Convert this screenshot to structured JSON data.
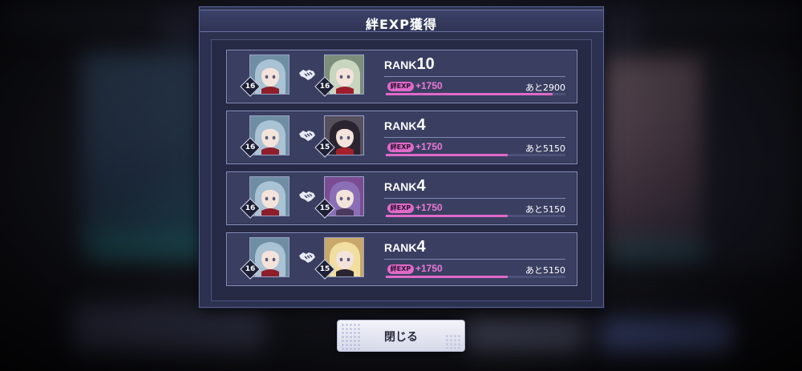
{
  "dialog": {
    "title": "絆EXP獲得"
  },
  "exp_pill_label": "絆EXP",
  "rows": [
    {
      "char_a_level": "16",
      "char_b_level": "16",
      "rank_label": "RANK",
      "rank_value": "10",
      "exp_gain": "+1750",
      "remaining": "あと2900",
      "progress": 0.93,
      "char_b_palette": {
        "hair": "#c9d6bf",
        "accent": "#9c1e2c",
        "bg": "#7d8f7a"
      }
    },
    {
      "char_a_level": "16",
      "char_b_level": "15",
      "rank_label": "RANK",
      "rank_value": "4",
      "exp_gain": "+1750",
      "remaining": "あと5150",
      "progress": 0.68,
      "char_b_palette": {
        "hair": "#2a2430",
        "accent": "#a3202c",
        "bg": "#55505c"
      }
    },
    {
      "char_a_level": "16",
      "char_b_level": "15",
      "rank_label": "RANK",
      "rank_value": "4",
      "exp_gain": "+1750",
      "remaining": "あと5150",
      "progress": 0.68,
      "char_b_palette": {
        "hair": "#8a6fb6",
        "accent": "#4b3a5c",
        "bg": "#7a4d92"
      }
    },
    {
      "char_a_level": "16",
      "char_b_level": "15",
      "rank_label": "RANK",
      "rank_value": "4",
      "exp_gain": "+1750",
      "remaining": "あと5150",
      "progress": 0.68,
      "char_b_palette": {
        "hair": "#f0dfa0",
        "accent": "#2a2430",
        "bg": "#c9a96a"
      }
    }
  ],
  "char_a_palette": {
    "hair": "#a9c2d4",
    "accent": "#8e1e2a",
    "bg": "#6f8ea3"
  },
  "icons": {
    "link": "handshake-icon"
  },
  "colors": {
    "accent": "#e06ac8",
    "panel": "#2c3150"
  },
  "close_button": {
    "label": "閉じる"
  }
}
